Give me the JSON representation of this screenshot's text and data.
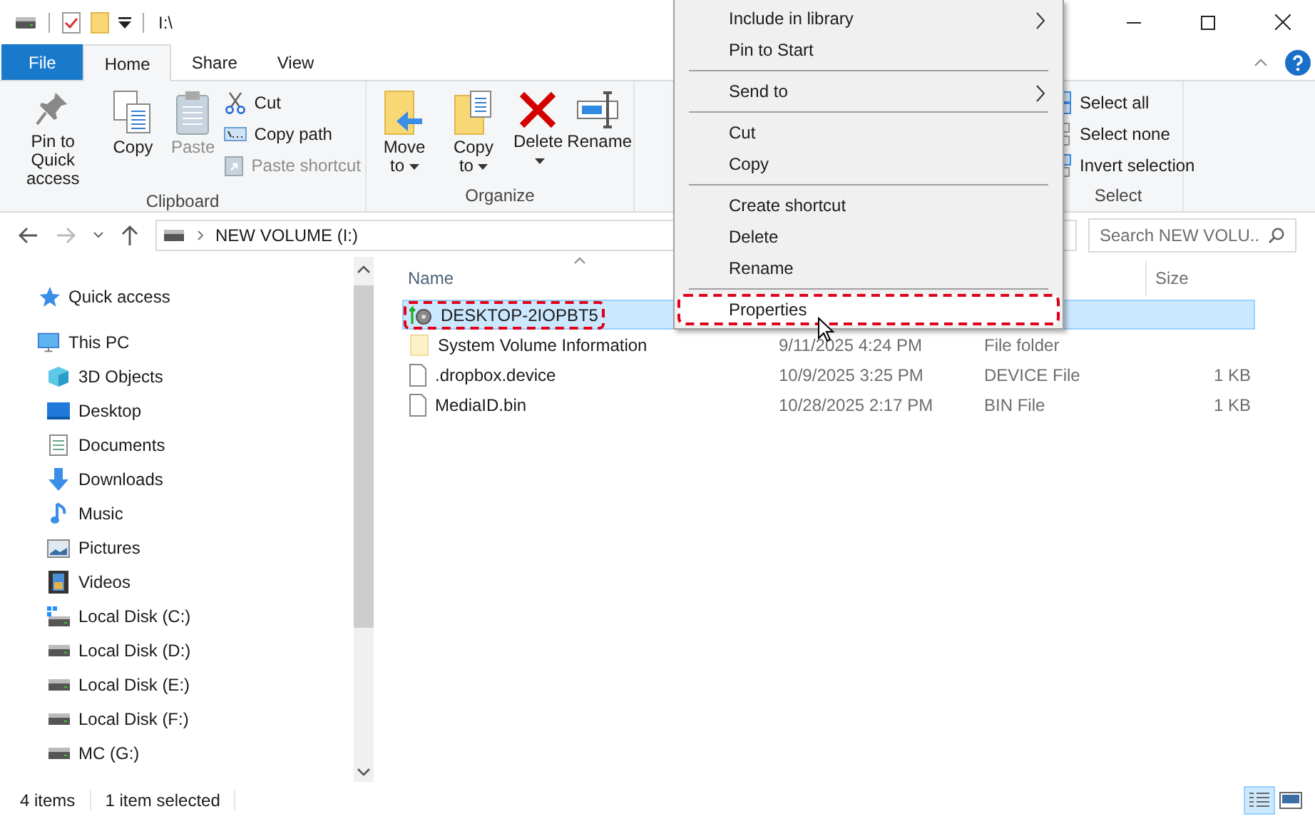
{
  "window": {
    "title": "I:\\"
  },
  "ribbon_tabs": [
    {
      "label": "File",
      "kind": "file",
      "selected": false
    },
    {
      "label": "Home",
      "kind": "tab",
      "selected": true
    },
    {
      "label": "Share",
      "kind": "tab",
      "selected": false
    },
    {
      "label": "View",
      "kind": "tab",
      "selected": false
    }
  ],
  "ribbon_groups": [
    {
      "label": "Clipboard",
      "large": [
        {
          "label": "Pin to Quick access",
          "kind": "pin",
          "disabled": false,
          "has_menu": false
        },
        {
          "label": "Copy",
          "kind": "copy",
          "disabled": false,
          "has_menu": false
        },
        {
          "label": "Paste",
          "kind": "paste",
          "disabled": true,
          "has_menu": false
        }
      ],
      "small": [
        {
          "label": "Cut",
          "kind": "cut",
          "disabled": false
        },
        {
          "label": "Copy path",
          "kind": "copy-path",
          "disabled": false
        },
        {
          "label": "Paste shortcut",
          "kind": "paste-shortcut",
          "disabled": true
        }
      ]
    },
    {
      "label": "Organize",
      "large": [
        {
          "label": "Move to",
          "kind": "move",
          "disabled": false,
          "has_menu": true
        },
        {
          "label": "Copy to",
          "kind": "copy-to",
          "disabled": false,
          "has_menu": true
        },
        {
          "label": "Delete",
          "kind": "delete",
          "disabled": false,
          "has_menu": true
        },
        {
          "label": "Rename",
          "kind": "rename",
          "disabled": false,
          "has_menu": false
        }
      ]
    },
    {
      "label": "Select",
      "small": [
        {
          "label": "Select all",
          "kind": "select-all",
          "disabled": false
        },
        {
          "label": "Select none",
          "kind": "select-none",
          "disabled": false
        },
        {
          "label": "Invert selection",
          "kind": "invert",
          "disabled": false
        }
      ]
    }
  ],
  "address": {
    "path": "NEW VOLUME (I:)",
    "search_placeholder": "Search NEW VOLU..."
  },
  "nav_pane": [
    {
      "label": "Quick access",
      "kind": "star"
    },
    {
      "label": "This PC",
      "kind": "pc",
      "children": [
        {
          "label": "3D Objects",
          "kind": "cube"
        },
        {
          "label": "Desktop",
          "kind": "desktop"
        },
        {
          "label": "Documents",
          "kind": "docs"
        },
        {
          "label": "Downloads",
          "kind": "download"
        },
        {
          "label": "Music",
          "kind": "music"
        },
        {
          "label": "Pictures",
          "kind": "pictures"
        },
        {
          "label": "Videos",
          "kind": "videos"
        },
        {
          "label": "Local Disk (C:)",
          "kind": "system-drive"
        },
        {
          "label": "Local Disk (D:)",
          "kind": "drive"
        },
        {
          "label": "Local Disk (E:)",
          "kind": "drive"
        },
        {
          "label": "Local Disk (F:)",
          "kind": "drive"
        },
        {
          "label": "MC (G:)",
          "kind": "drive"
        }
      ]
    }
  ],
  "file_list": {
    "columns": [
      "Name",
      "Size"
    ],
    "rows": [
      {
        "name": "DESKTOP-2IOPBT5",
        "kind": "network",
        "selected": true,
        "highlighted": true
      },
      {
        "name": "System Volume Information",
        "kind": "folder",
        "date": "9/11/2025 4:24 PM",
        "type": "File folder",
        "selected": false,
        "highlighted": false
      },
      {
        "name": ".dropbox.device",
        "kind": "file",
        "date": "10/9/2025 3:25 PM",
        "type": "DEVICE File",
        "size": "1 KB",
        "selected": false,
        "highlighted": false
      },
      {
        "name": "MediaID.bin",
        "kind": "file",
        "date": "10/28/2025 2:17 PM",
        "type": "BIN File",
        "size": "1 KB",
        "selected": false,
        "highlighted": false
      }
    ]
  },
  "context_menu": [
    {
      "label": "Include in library",
      "kind": "submenu",
      "hovered": false,
      "highlighted": false
    },
    {
      "label": "Pin to Start",
      "kind": "item",
      "hovered": false,
      "highlighted": false
    },
    {
      "kind": "separator"
    },
    {
      "label": "Send to",
      "kind": "submenu",
      "hovered": false,
      "highlighted": false
    },
    {
      "kind": "separator"
    },
    {
      "label": "Cut",
      "kind": "item",
      "hovered": false,
      "highlighted": false
    },
    {
      "label": "Copy",
      "kind": "item",
      "hovered": false,
      "highlighted": false
    },
    {
      "kind": "separator"
    },
    {
      "label": "Create shortcut",
      "kind": "item",
      "hovered": false,
      "highlighted": false
    },
    {
      "label": "Delete",
      "kind": "item",
      "hovered": false,
      "highlighted": false
    },
    {
      "label": "Rename",
      "kind": "item",
      "hovered": false,
      "highlighted": false
    },
    {
      "kind": "separator"
    },
    {
      "label": "Properties",
      "kind": "item",
      "hovered": true,
      "highlighted": true
    }
  ],
  "status_bar": {
    "items": [
      "4 items",
      "1 item selected"
    ],
    "views": [
      {
        "kind": "details",
        "selected": true
      },
      {
        "kind": "large-icons",
        "selected": false
      }
    ]
  }
}
